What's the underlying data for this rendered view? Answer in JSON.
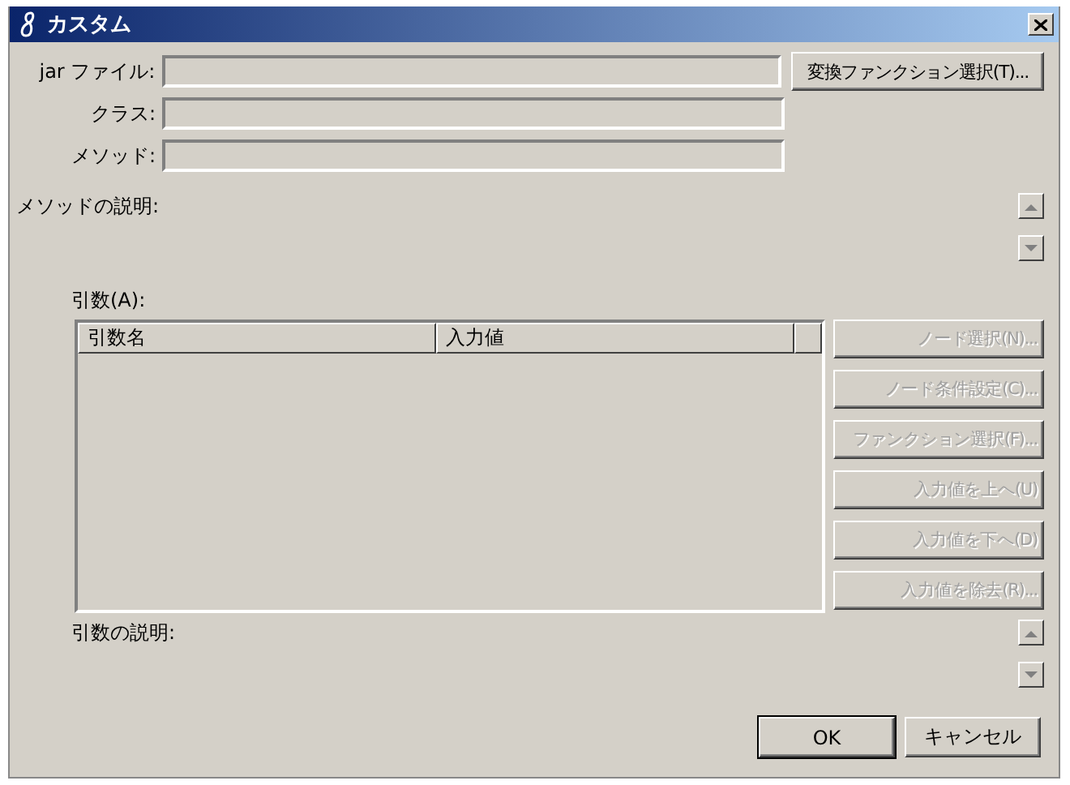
{
  "window": {
    "title": "カスタム"
  },
  "fields": [
    {
      "label": "jar ファイル:"
    },
    {
      "label": "クラス:"
    },
    {
      "label": "メソッド:"
    }
  ],
  "select_button": {
    "label": "変換ファンクション選択(T)..."
  },
  "method_description": {
    "label": "メソッドの説明:"
  },
  "arguments": {
    "label": "引数(A):",
    "columns": [
      "引数名",
      "入力値"
    ]
  },
  "side_buttons": [
    {
      "label": "ノード選択(N)...",
      "disabled": true
    },
    {
      "label": "ノード条件設定(C)...",
      "disabled": true
    },
    {
      "label": "ファンクション選択(F)...",
      "disabled": true
    },
    {
      "label": "入力値を上へ(U)",
      "disabled": true
    },
    {
      "label": "入力値を下へ(D)",
      "disabled": true
    },
    {
      "label": "入力値を除去(R)...",
      "disabled": true
    }
  ],
  "argument_description": {
    "label": "引数の説明:"
  },
  "buttons": [
    {
      "label": "OK",
      "default": true
    },
    {
      "label": "キャンセル",
      "default": false
    }
  ]
}
